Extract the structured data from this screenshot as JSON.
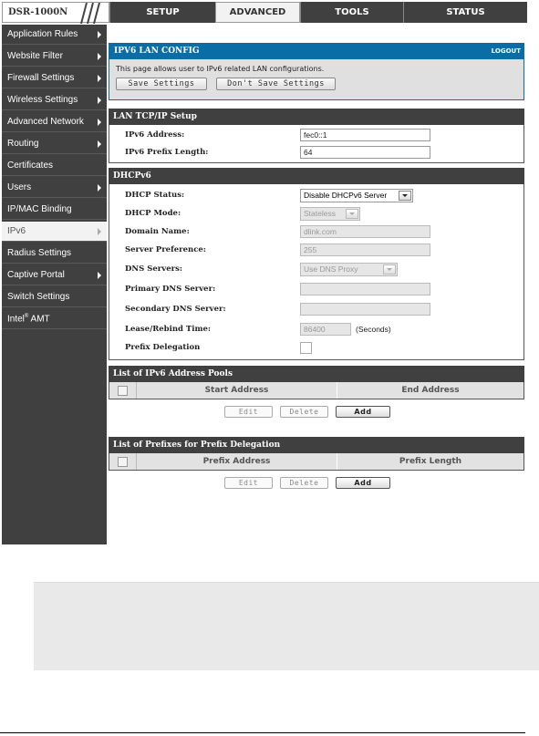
{
  "header": {
    "logo": "DSR-1000N",
    "tabs": [
      {
        "label": "SETUP",
        "active": false
      },
      {
        "label": "ADVANCED",
        "active": true
      },
      {
        "label": "TOOLS",
        "active": false
      },
      {
        "label": "STATUS",
        "active": false
      }
    ]
  },
  "sidebar": {
    "items": [
      {
        "label": "Application Rules",
        "has_arrow": true
      },
      {
        "label": "Website Filter",
        "has_arrow": true
      },
      {
        "label": "Firewall Settings",
        "has_arrow": true
      },
      {
        "label": "Wireless Settings",
        "has_arrow": true
      },
      {
        "label": "Advanced Network",
        "has_arrow": true
      },
      {
        "label": "Routing",
        "has_arrow": true
      },
      {
        "label": "Certificates",
        "has_arrow": false
      },
      {
        "label": "Users",
        "has_arrow": true
      },
      {
        "label": "IP/MAC Binding",
        "has_arrow": false
      },
      {
        "label": "IPv6",
        "has_arrow": true,
        "active": true
      },
      {
        "label": "Radius Settings",
        "has_arrow": false
      },
      {
        "label": "Captive Portal",
        "has_arrow": true
      },
      {
        "label": "Switch Settings",
        "has_arrow": false
      },
      {
        "label": "Intel",
        "sup": "®",
        "label_suffix": " AMT",
        "has_arrow": false
      }
    ]
  },
  "config": {
    "title": "IPV6 LAN CONFIG",
    "logout": "LOGOUT",
    "description": "This page allows user to IPv6 related LAN configurations.",
    "save_label": "Save Settings",
    "dont_save_label": "Don't Save Settings"
  },
  "lan_setup": {
    "title": "LAN TCP/IP Setup",
    "ipv6_address_label": "IPv6 Address:",
    "ipv6_address_value": "fec0::1",
    "prefix_length_label": "IPv6 Prefix Length:",
    "prefix_length_value": "64"
  },
  "dhcpv6": {
    "title": "DHCPv6",
    "status_label": "DHCP Status:",
    "status_value": "Disable DHCPv6 Server",
    "mode_label": "DHCP Mode:",
    "mode_value": "Stateless",
    "domain_label": "Domain Name:",
    "domain_value": "dlink.com",
    "pref_label": "Server Preference:",
    "pref_value": "255",
    "dns_label": "DNS Servers:",
    "dns_value": "Use DNS Proxy",
    "primary_dns_label": "Primary DNS Server:",
    "primary_dns_value": "",
    "secondary_dns_label": "Secondary DNS Server:",
    "secondary_dns_value": "",
    "lease_label": "Lease/Rebind Time:",
    "lease_value": "86400",
    "lease_unit": "(Seconds)",
    "prefix_delegation_label": "Prefix Delegation",
    "prefix_delegation_checked": false
  },
  "pools": {
    "title": "List of IPv6 Address Pools",
    "columns": [
      "Start Address",
      "End Address"
    ],
    "rows": [],
    "edit_label": "Edit",
    "delete_label": "Delete",
    "add_label": "Add"
  },
  "prefixes": {
    "title": "List of Prefixes for Prefix Delegation",
    "columns": [
      "Prefix Address",
      "Prefix Length"
    ],
    "rows": [],
    "edit_label": "Edit",
    "delete_label": "Delete",
    "add_label": "Add"
  }
}
